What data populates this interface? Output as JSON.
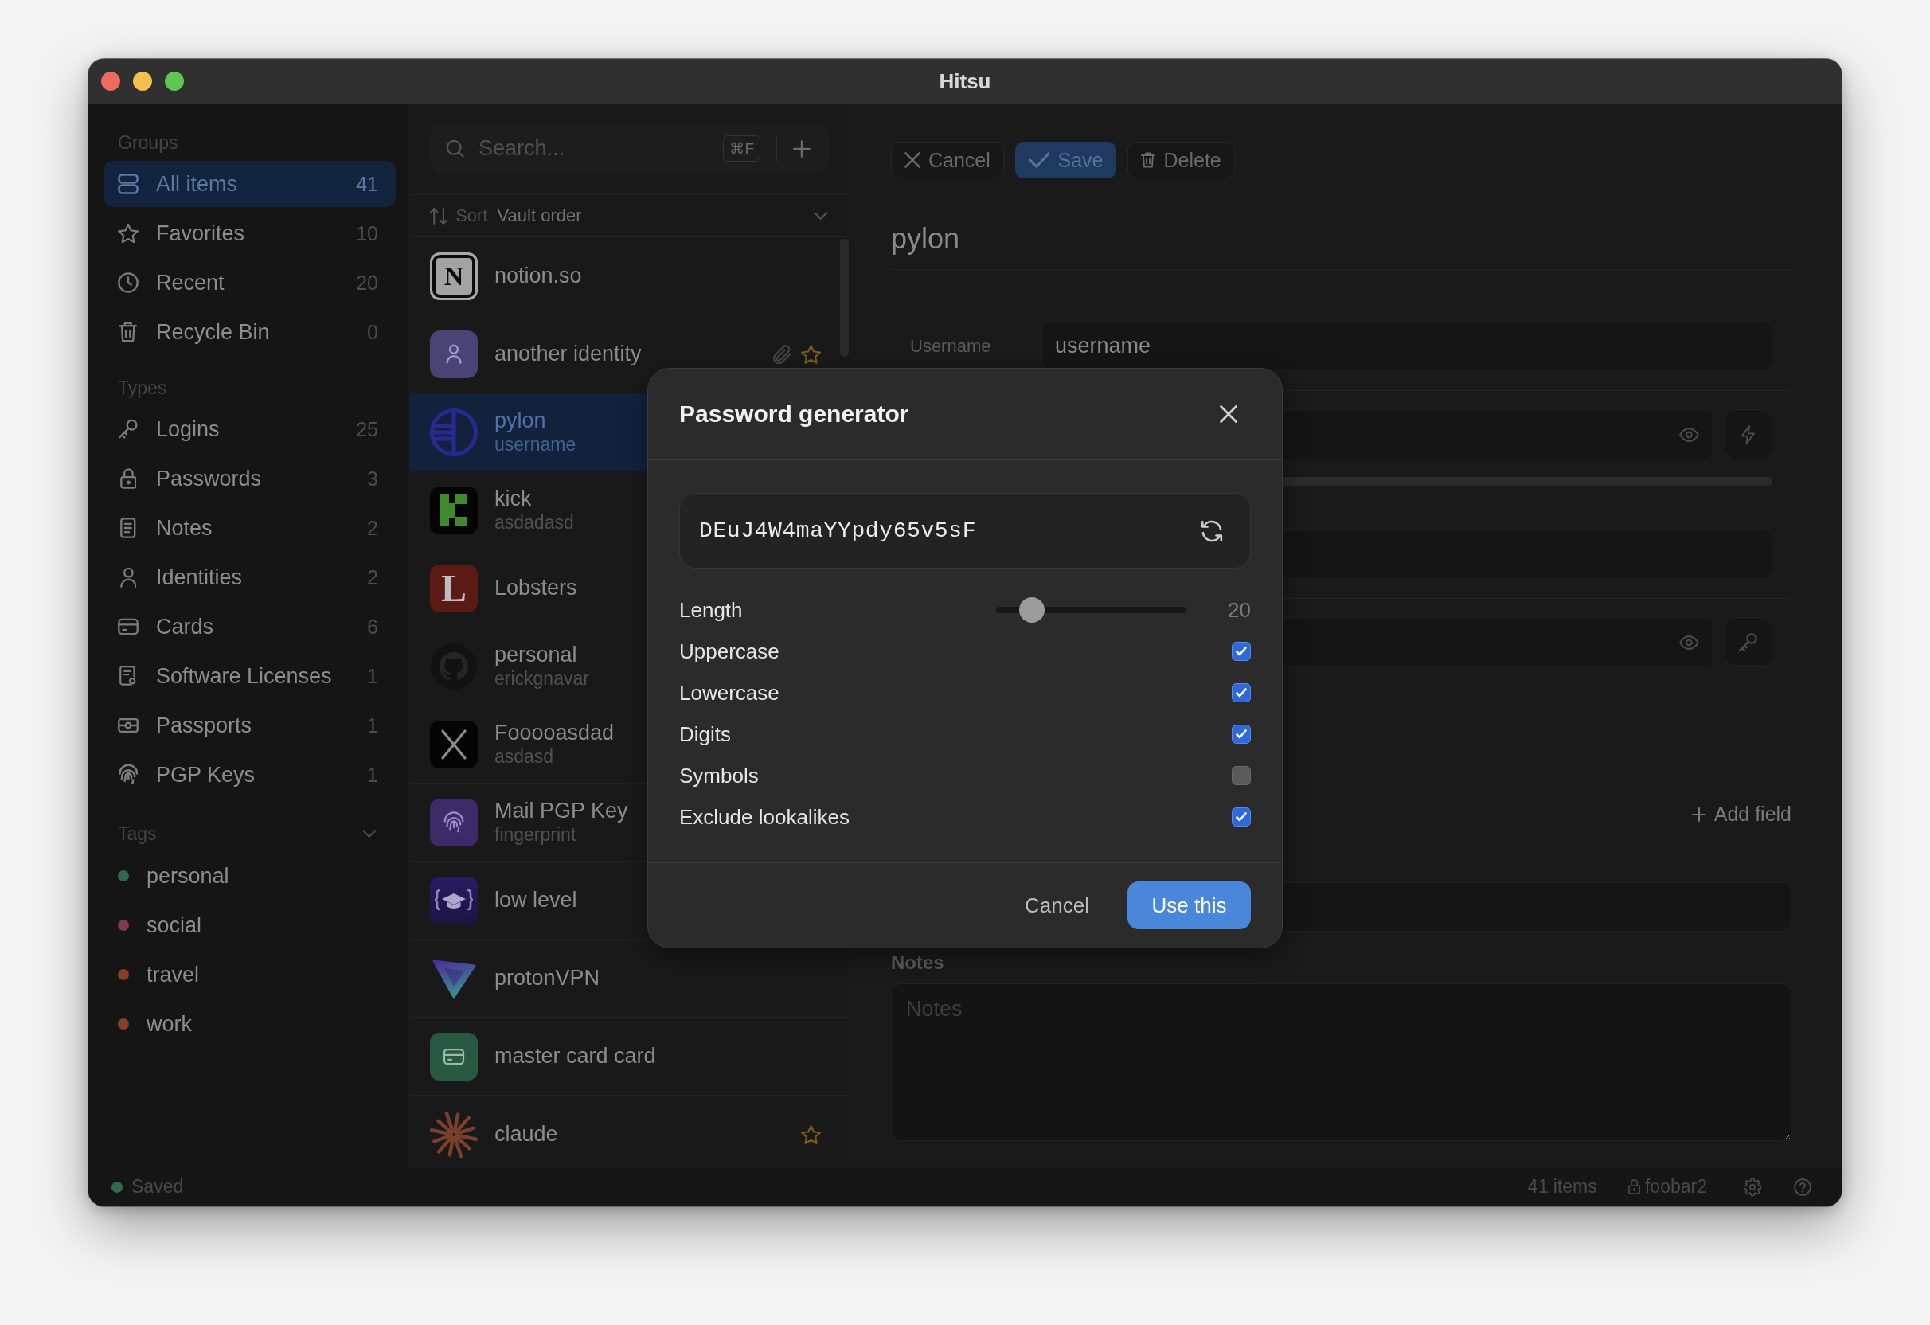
{
  "window": {
    "title": "Hitsu"
  },
  "sidebar": {
    "sections": [
      {
        "heading": "Groups",
        "items": [
          {
            "label": "All items",
            "count": "41",
            "selected": true
          },
          {
            "label": "Favorites",
            "count": "10",
            "selected": false
          },
          {
            "label": "Recent",
            "count": "20",
            "selected": false
          },
          {
            "label": "Recycle Bin",
            "count": "0",
            "selected": false
          }
        ]
      },
      {
        "heading": "Types",
        "items": [
          {
            "label": "Logins",
            "count": "25",
            "selected": false
          },
          {
            "label": "Passwords",
            "count": "3",
            "selected": false
          },
          {
            "label": "Notes",
            "count": "2",
            "selected": false
          },
          {
            "label": "Identities",
            "count": "2",
            "selected": false
          },
          {
            "label": "Cards",
            "count": "6",
            "selected": false
          },
          {
            "label": "Software Licenses",
            "count": "1",
            "selected": false
          },
          {
            "label": "Passports",
            "count": "1",
            "selected": false
          },
          {
            "label": "PGP Keys",
            "count": "1",
            "selected": false
          }
        ]
      }
    ],
    "tags": {
      "heading": "Tags",
      "expanded": true,
      "items": [
        {
          "label": "personal",
          "color": "#2e6a4e"
        },
        {
          "label": "social",
          "color": "#7b3a55"
        },
        {
          "label": "travel",
          "color": "#86402a"
        },
        {
          "label": "work",
          "color": "#86402a"
        }
      ]
    }
  },
  "item_list": {
    "search": {
      "placeholder": "Search...",
      "shortcut": "⌘F"
    },
    "sort": {
      "label": "Sort",
      "value": "Vault order"
    },
    "items": [
      {
        "title": "notion.so",
        "logo_letter": "N",
        "attachment": false,
        "favorite": false,
        "selected": false
      },
      {
        "title": "another identity",
        "attachment": true,
        "favorite": true,
        "selected": false
      },
      {
        "title": "pylon",
        "subtitle": "username",
        "attachment": false,
        "favorite": false,
        "selected": true
      },
      {
        "title": "kick",
        "subtitle": "asdadasd",
        "attachment": false,
        "favorite": false,
        "selected": false
      },
      {
        "title": "Lobsters",
        "logo_letter": "L",
        "attachment": false,
        "favorite": false,
        "selected": false
      },
      {
        "title": "personal",
        "subtitle": "erickgnavar",
        "attachment": false,
        "favorite": false,
        "selected": false
      },
      {
        "title": "Fooooasdad",
        "subtitle": "asdasd",
        "attachment": false,
        "favorite": false,
        "selected": false
      },
      {
        "title": "Mail PGP Key",
        "subtitle": "fingerprint",
        "attachment": false,
        "favorite": false,
        "selected": false
      },
      {
        "title": "low level",
        "attachment": false,
        "favorite": false,
        "selected": false
      },
      {
        "title": "protonVPN",
        "attachment": false,
        "favorite": false,
        "selected": false
      },
      {
        "title": "master card card",
        "attachment": false,
        "favorite": false,
        "selected": false
      },
      {
        "title": "claude",
        "attachment": false,
        "favorite": true,
        "selected": false
      }
    ]
  },
  "detail": {
    "actions": [
      {
        "label": "Cancel",
        "kind": "cancel"
      },
      {
        "label": "Save",
        "kind": "save"
      },
      {
        "label": "Delete",
        "kind": "delete"
      }
    ],
    "title": "pylon",
    "fields": [
      {
        "kind": "text",
        "label": "Username",
        "value": "username"
      },
      {
        "kind": "password"
      },
      {
        "kind": "blank"
      },
      {
        "kind": "secret"
      }
    ],
    "add_field": "Add field",
    "extra_fields": [
      {
        "kind": "blank"
      }
    ],
    "notes": {
      "label": "Notes",
      "placeholder": "Notes"
    }
  },
  "status_bar": {
    "status": "Saved",
    "item_count": "41 items",
    "vault": "foobar2"
  },
  "password_generator": {
    "title": "Password generator",
    "password": "DEuJ4W4maYYpdy65v5sF",
    "length": {
      "label": "Length",
      "level": 0.14,
      "reading": "20"
    },
    "options": [
      {
        "label": "Uppercase",
        "checked": true
      },
      {
        "label": "Lowercase",
        "checked": true
      },
      {
        "label": "Digits",
        "checked": true
      },
      {
        "label": "Symbols",
        "checked": false
      },
      {
        "label": "Exclude lookalikes",
        "checked": true
      }
    ],
    "buttons": [
      {
        "label": "Cancel",
        "kind": "secondary"
      },
      {
        "label": "Use this",
        "kind": "primary"
      }
    ]
  }
}
